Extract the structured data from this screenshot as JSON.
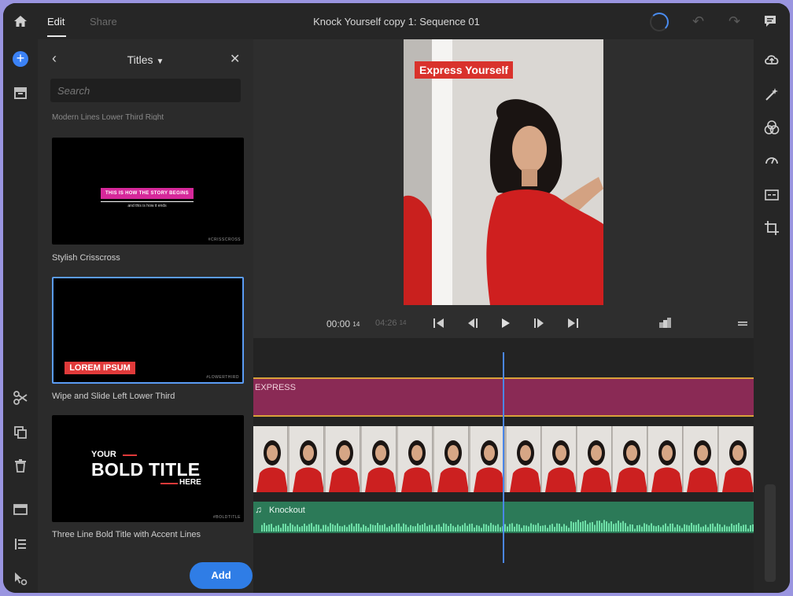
{
  "topbar": {
    "tab_edit": "Edit",
    "tab_share": "Share",
    "sequence_title": "Knock Yourself copy 1: Sequence 01"
  },
  "panel": {
    "title": "Titles",
    "search_placeholder": "Search",
    "cutoff_caption": "Modern Lines Lower Third Right",
    "items": [
      {
        "caption": "Stylish Crisscross",
        "preview_text": "THIS IS HOW THE STORY BEGINS",
        "preview_sub": "and this is how it ends",
        "watermark": "#CRISSCROSS"
      },
      {
        "caption": "Wipe and Slide Left Lower Third",
        "preview_text": "LOREM IPSUM",
        "watermark": "#LOWERTHIRD"
      },
      {
        "caption": "Three Line Bold Title with Accent Lines",
        "preview_line1": "YOUR",
        "preview_line2": "BOLD TITLE",
        "preview_line3": "HERE",
        "watermark": "#BOLDTITLE"
      }
    ],
    "add_button": "Add"
  },
  "viewer": {
    "overlay_text": "Express Yourself",
    "time_current": "00:00",
    "time_current_frames": "14",
    "time_duration": "04:26",
    "time_duration_frames": "14"
  },
  "timeline": {
    "title_clip_label": "EXPRESS",
    "audio_clip_label": "Knockout"
  },
  "colors": {
    "accent_blue": "#2f7de6",
    "title_track": "#8a2a55",
    "audio_track": "#2c7a58",
    "playhead": "#4a86e8"
  }
}
